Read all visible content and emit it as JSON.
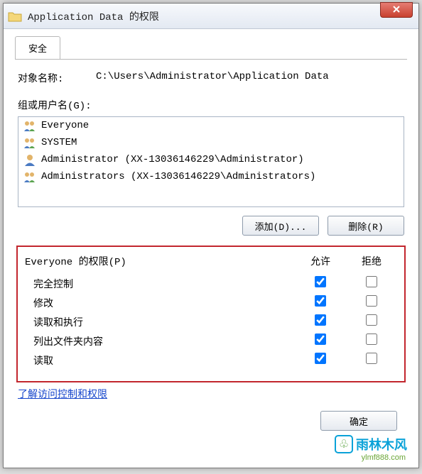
{
  "window": {
    "title": "Application Data 的权限"
  },
  "tabs": {
    "security": "安全"
  },
  "object": {
    "label": "对象名称:",
    "value": "C:\\Users\\Administrator\\Application Data"
  },
  "groups": {
    "label": "组或用户名(G):",
    "items": [
      {
        "name": "Everyone"
      },
      {
        "name": "SYSTEM"
      },
      {
        "name": "Administrator (XX-13036146229\\Administrator)"
      },
      {
        "name": "Administrators (XX-13036146229\\Administrators)"
      }
    ]
  },
  "buttons": {
    "add": "添加(D)...",
    "remove": "删除(R)",
    "ok": "确定"
  },
  "permissions": {
    "header_label": "Everyone 的权限(P)",
    "col_allow": "允许",
    "col_deny": "拒绝",
    "rows": [
      {
        "name": "完全控制",
        "allow": true,
        "deny": false
      },
      {
        "name": "修改",
        "allow": true,
        "deny": false
      },
      {
        "name": "读取和执行",
        "allow": true,
        "deny": false
      },
      {
        "name": "列出文件夹内容",
        "allow": true,
        "deny": false
      },
      {
        "name": "读取",
        "allow": true,
        "deny": false
      }
    ]
  },
  "link": {
    "text": "了解访问控制和权限"
  },
  "brand": {
    "text": "雨林木风",
    "sub": "ylmf888.com"
  }
}
